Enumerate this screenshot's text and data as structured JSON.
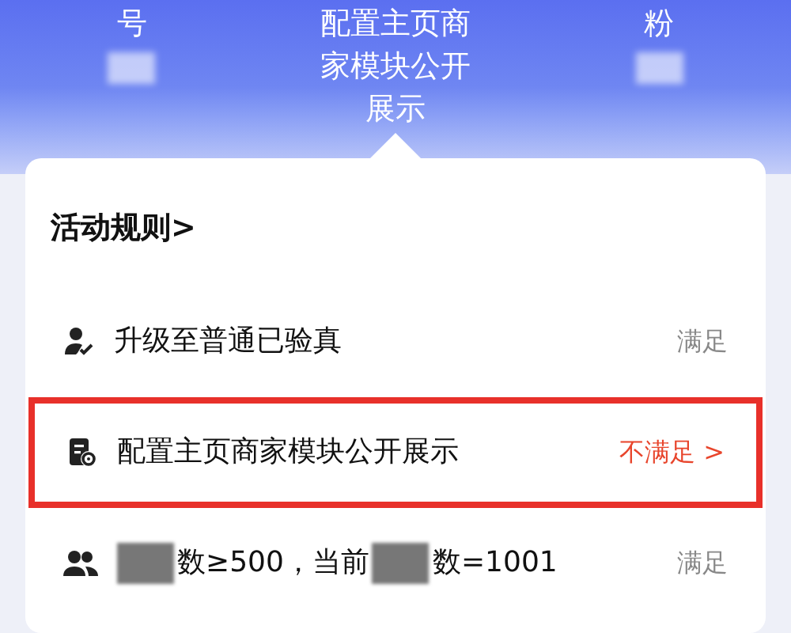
{
  "header": {
    "columns": [
      {
        "lines": [
          "号"
        ]
      },
      {
        "lines": [
          "配置主页商",
          "家模块公开",
          "展示"
        ]
      },
      {
        "lines": [
          "粉"
        ]
      }
    ]
  },
  "rules": {
    "title": "活动规则",
    "chevron": ">"
  },
  "items": [
    {
      "kind": "verified",
      "parts": [
        "升级至普通已验真"
      ],
      "status": "满足",
      "met": true,
      "highlighted": false
    },
    {
      "kind": "shop",
      "parts": [
        "配置主页商家模块公开展示"
      ],
      "status": "不满足",
      "met": false,
      "highlighted": true,
      "chevron": ">"
    },
    {
      "kind": "fans",
      "parts": [
        "数≥500，当前",
        "数=1001"
      ],
      "status": "满足",
      "met": true,
      "highlighted": false
    }
  ]
}
